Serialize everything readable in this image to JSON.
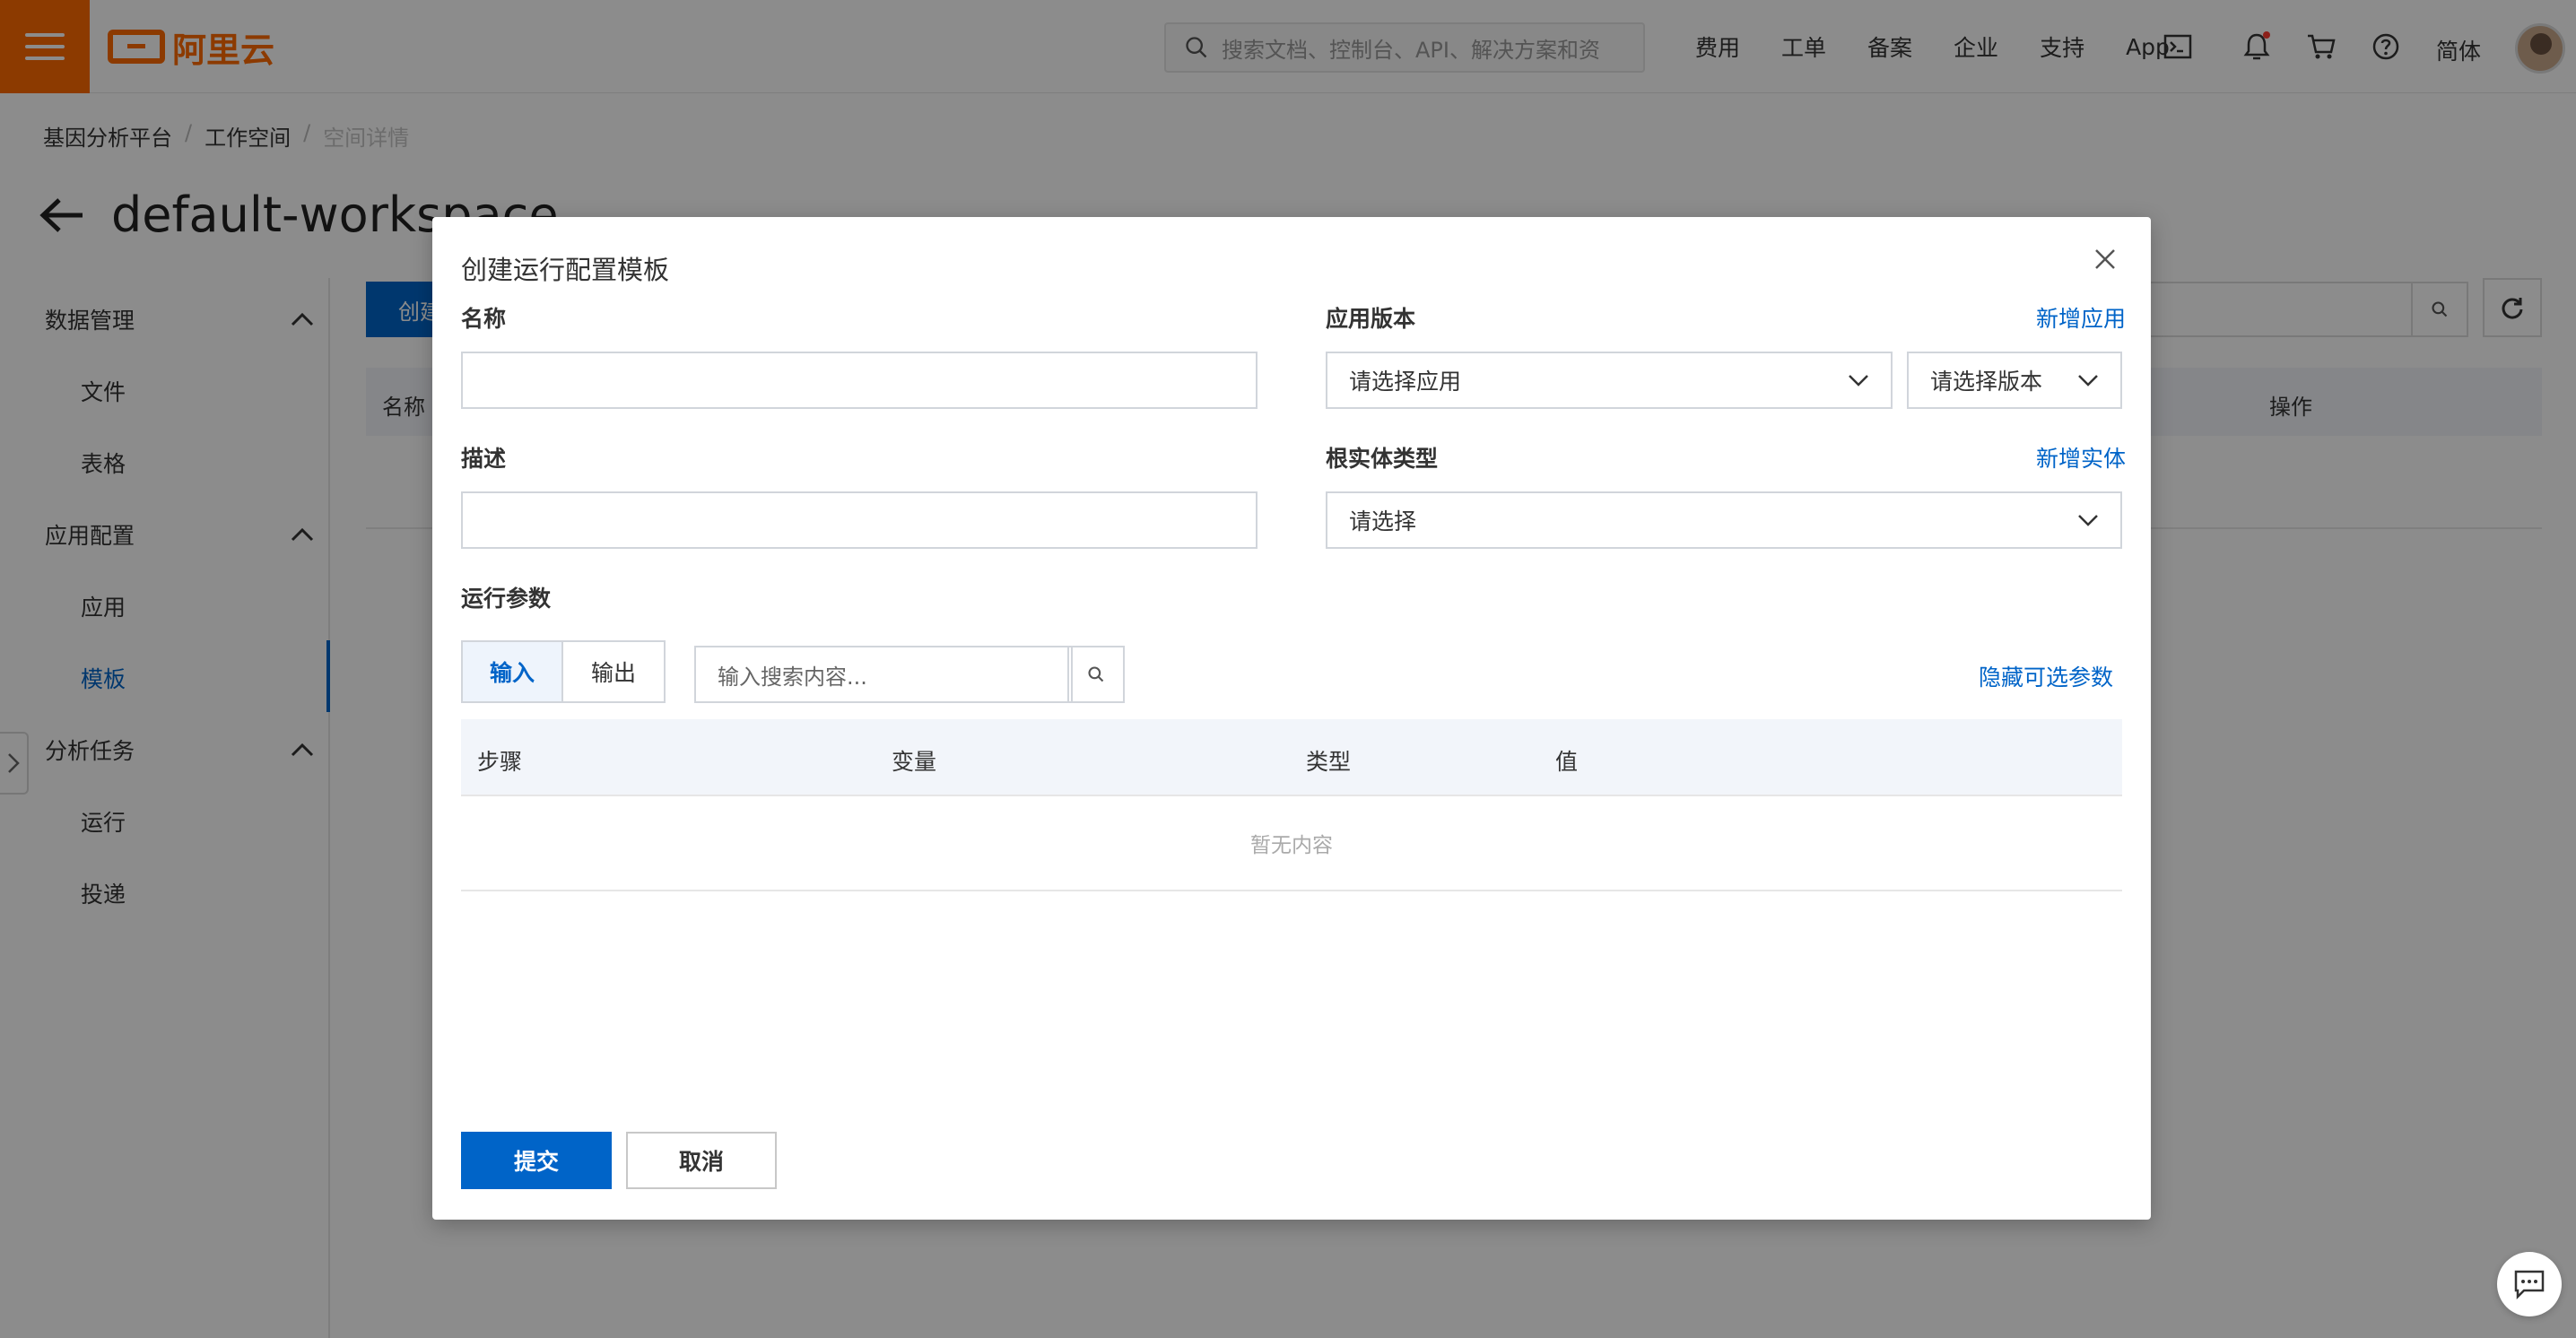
{
  "brand": {
    "logo_text": "阿里云"
  },
  "topbar": {
    "search_placeholder": "搜索文档、控制台、API、解决方案和资",
    "nav": [
      "费用",
      "工单",
      "备案",
      "企业",
      "支持",
      "App"
    ],
    "lang": "简体",
    "icons": [
      "terminal-icon",
      "bell-icon",
      "cart-icon",
      "help-icon"
    ]
  },
  "breadcrumb": [
    "基因分析平台",
    "工作空间",
    "空间详情"
  ],
  "page": {
    "title": "default-workspace"
  },
  "sidebar": {
    "groups": [
      {
        "label": "数据管理",
        "items": [
          "文件",
          "表格"
        ]
      },
      {
        "label": "应用配置",
        "items": [
          "应用",
          "模板"
        ]
      },
      {
        "label": "分析任务",
        "items": [
          "运行",
          "投递"
        ]
      }
    ],
    "active_item": "模板"
  },
  "background": {
    "create_button": "创建",
    "table_headers": [
      "名称",
      "操作"
    ]
  },
  "modal": {
    "title": "创建运行配置模板",
    "name_label": "名称",
    "name_value": "",
    "desc_label": "描述",
    "desc_value": "",
    "app_version_label": "应用版本",
    "add_app_link": "新增应用",
    "app_select": "请选择应用",
    "version_select": "请选择版本",
    "root_entity_label": "根实体类型",
    "add_entity_link": "新增实体",
    "root_entity_select": "请选择",
    "params_label": "运行参数",
    "tabs": [
      "输入",
      "输出"
    ],
    "active_tab": "输入",
    "param_search_placeholder": "输入搜索内容...",
    "hide_optional_link": "隐藏可选参数",
    "table_headers": [
      "步骤",
      "变量",
      "类型",
      "值"
    ],
    "empty_text": "暂无内容",
    "submit_label": "提交",
    "cancel_label": "取消"
  },
  "colors": {
    "brand": "#ff6a00",
    "primary": "#0064c8",
    "table_head": "#f2f5fa"
  }
}
